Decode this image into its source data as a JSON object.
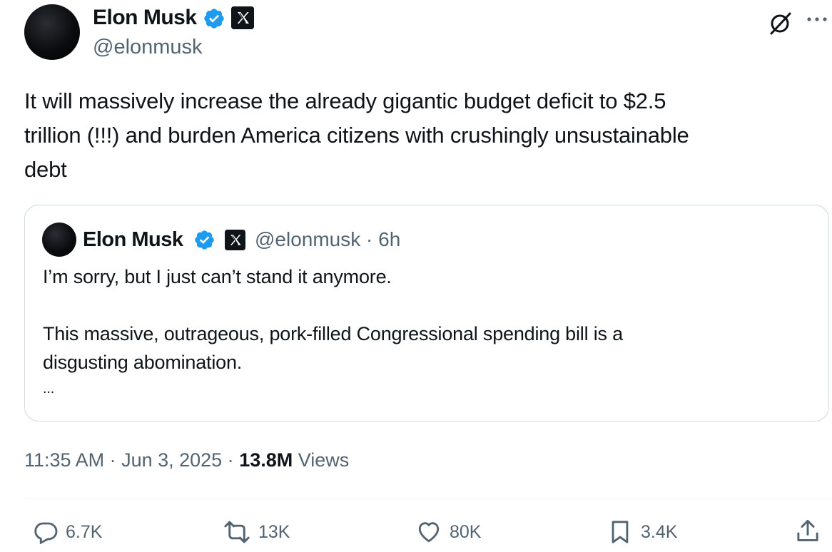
{
  "tweet": {
    "author": {
      "name": "Elon Musk",
      "handle": "@elonmusk",
      "verified": true,
      "affiliate_badge": "X"
    },
    "text_lines": [
      "It will massively increase the already gigantic budget deficit to $2.5",
      "trillion (!!!) and burden America citizens with crushingly unsustainable",
      "debt"
    ],
    "quoted": {
      "author": {
        "name": "Elon Musk",
        "handle": "@elonmusk",
        "time": "· 6h"
      },
      "line1": "I’m sorry, but I just can’t stand it anymore.",
      "line2": "This massive, outrageous, pork-filled Congressional spending bill is a",
      "line3": "disgusting abomination.",
      "more": "..."
    },
    "meta": {
      "time": "11:35 AM · Jun 3, 2025 · ",
      "views_count": "13.8M",
      "views_label": " Views"
    },
    "actions": {
      "replies": "6.7K",
      "reposts": "13K",
      "likes": "80K",
      "bookmarks": "3.4K"
    }
  },
  "icons": {
    "verified": "verified-badge-icon",
    "x_logo": "x-logo-icon",
    "grok": "grok-icon",
    "more": "more-dots-icon",
    "reply": "reply-icon",
    "repost": "repost-icon",
    "like": "heart-icon",
    "bookmark": "bookmark-icon",
    "share": "share-icon"
  },
  "colors": {
    "verified_blue": "#1d9bf0",
    "text": "#0f1419",
    "secondary": "#536471",
    "border": "#cfd9de"
  }
}
